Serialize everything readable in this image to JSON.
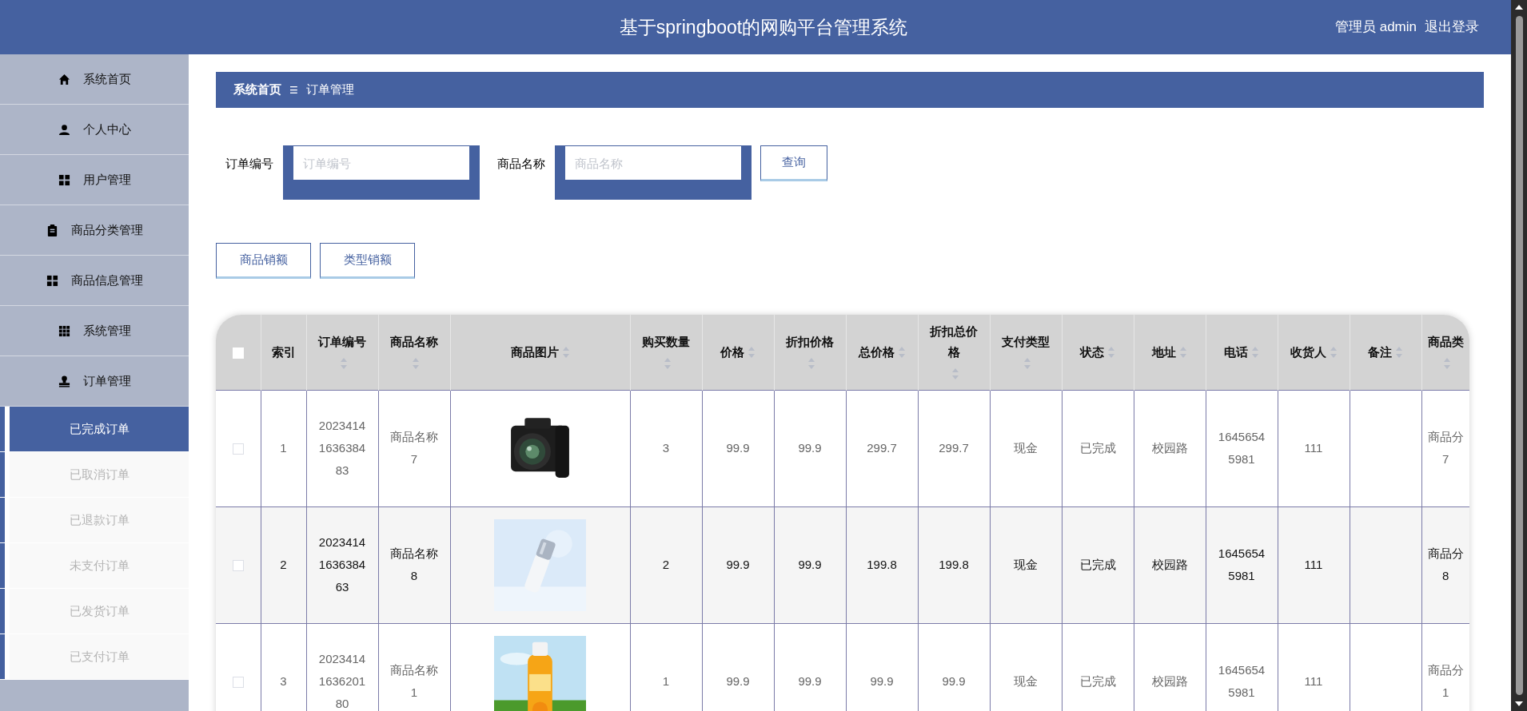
{
  "header": {
    "title": "基于springboot的网购平台管理系统",
    "user": "管理员 admin",
    "logout": "退出登录"
  },
  "sidebar": {
    "items": [
      {
        "label": "系统首页"
      },
      {
        "label": "个人中心"
      },
      {
        "label": "用户管理"
      },
      {
        "label": "商品分类管理"
      },
      {
        "label": "商品信息管理"
      },
      {
        "label": "系统管理"
      },
      {
        "label": "订单管理",
        "expanded": true,
        "children": [
          {
            "label": "已完成订单",
            "selected": true
          },
          {
            "label": "已取消订单",
            "selected": false
          },
          {
            "label": "已退款订单",
            "selected": false
          },
          {
            "label": "未支付订单",
            "selected": false
          },
          {
            "label": "已发货订单",
            "selected": false
          },
          {
            "label": "已支付订单",
            "selected": false
          }
        ]
      }
    ]
  },
  "breadcrumb": {
    "items": [
      "系统首页",
      "订单管理"
    ],
    "separator": "☰"
  },
  "search": {
    "fields": [
      {
        "label": "订单编号",
        "placeholder": "订单编号"
      },
      {
        "label": "商品名称",
        "placeholder": "商品名称"
      }
    ],
    "button": "查询"
  },
  "actions": [
    "商品销额",
    "类型销额"
  ],
  "table": {
    "header_checked": false,
    "columns": [
      {
        "label": "索引",
        "sortable": false
      },
      {
        "label": "订单编号",
        "sortable": true
      },
      {
        "label": "商品名称",
        "sortable": true
      },
      {
        "label": "商品图片",
        "sortable": true,
        "kind": "picture"
      },
      {
        "label": "购买数量",
        "sortable": true
      },
      {
        "label": "价格",
        "sortable": true
      },
      {
        "label": "折扣价格",
        "sortable": true
      },
      {
        "label": "总价格",
        "sortable": true
      },
      {
        "label": "折扣总价格",
        "sortable": true
      },
      {
        "label": "支付类型",
        "sortable": true
      },
      {
        "label": "状态",
        "sortable": true
      },
      {
        "label": "地址",
        "sortable": true
      },
      {
        "label": "电话",
        "sortable": true
      },
      {
        "label": "收货人",
        "sortable": true
      },
      {
        "label": "备注",
        "sortable": true
      },
      {
        "label": "商品类",
        "sortable": true
      }
    ],
    "rows": [
      {
        "checked": false,
        "highlighted": false,
        "cells": [
          "1",
          "2023414163638483",
          "商品名称7",
          {
            "kind": "picture"
          },
          "3",
          "99.9",
          "99.9",
          "299.7",
          "299.7",
          "现金",
          "已完成",
          "校园路",
          "16456545981",
          "111",
          "",
          "商品分7"
        ]
      },
      {
        "checked": false,
        "highlighted": true,
        "cells": [
          "2",
          "2023414163638463",
          "商品名称8",
          {
            "kind": "picture"
          },
          "2",
          "99.9",
          "99.9",
          "199.8",
          "199.8",
          "现金",
          "已完成",
          "校园路",
          "16456545981",
          "111",
          "",
          "商品分8"
        ]
      },
      {
        "checked": false,
        "highlighted": false,
        "cells": [
          "3",
          "2023414163620180",
          "商品名称1",
          {
            "kind": "picture"
          },
          "1",
          "99.9",
          "99.9",
          "99.9",
          "99.9",
          "现金",
          "已完成",
          "校园路",
          "16456545981",
          "111",
          "",
          "商品分1"
        ]
      }
    ]
  }
}
